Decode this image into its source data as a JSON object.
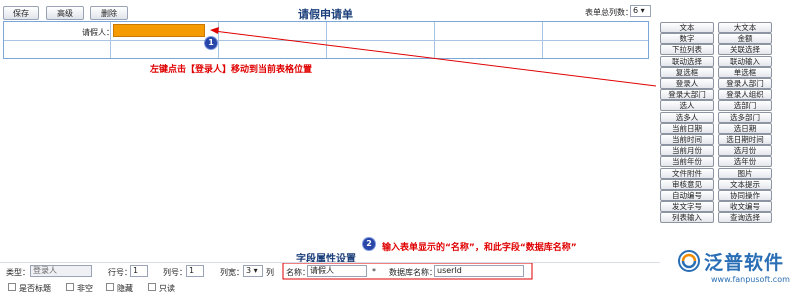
{
  "toolbar": {
    "save_label": "保存",
    "advanced_label": "高级",
    "delete_label": "删除"
  },
  "form": {
    "title": "请假申请单",
    "applicant_label": "请假人："
  },
  "column_setting": {
    "label": "表单总列数：",
    "value": "6 ▾"
  },
  "palette": {
    "items": [
      "文本",
      "大文本",
      "数字",
      "金额",
      "下拉列表",
      "关联选择",
      "联动选择",
      "联动输入",
      "复选框",
      "单选框",
      "登录人",
      "登录人部门",
      "登录大部门",
      "登录人组织",
      "选人",
      "选部门",
      "选多人",
      "选多部门",
      "当前日期",
      "选日期",
      "当前时间",
      "选日期时间",
      "当前月份",
      "选月份",
      "当前年份",
      "选年份",
      "文件附件",
      "图片",
      "审核意见",
      "文本提示",
      "自动编号",
      "协同操作",
      "发文字号",
      "收文编号",
      "列表输入",
      "查询选择"
    ]
  },
  "annotations": {
    "step1_badge": "1",
    "step1_text": "左键点击【登录人】移动到当前表格位置",
    "step2_badge": "2",
    "step2_text": "输入表单显示的“名称”，和此字段“数据库名称”"
  },
  "props": {
    "title": "字段属性设置",
    "type_label": "类型：",
    "type_value": "登录人",
    "row_label": "行号：",
    "row_value": "1",
    "col_label": "列号：",
    "col_value": "1",
    "width_label": "列宽：",
    "width_value": "3 ▾",
    "width_unit": "列",
    "name_label": "名称：",
    "name_value": "请假人",
    "required_mark": "*",
    "dbname_label": "数据库名称：",
    "dbname_value": "userId"
  },
  "checkboxes": [
    "是否标题",
    "非空",
    "隐藏",
    "只读"
  ],
  "logo": {
    "text": "泛普软件",
    "url": "www.fanpusoft.com"
  },
  "colors": {
    "highlight_cell": "#f59a00",
    "hint_red": "#e00000",
    "title_blue": "#1b3f7a",
    "badge_blue": "#2746a8"
  }
}
